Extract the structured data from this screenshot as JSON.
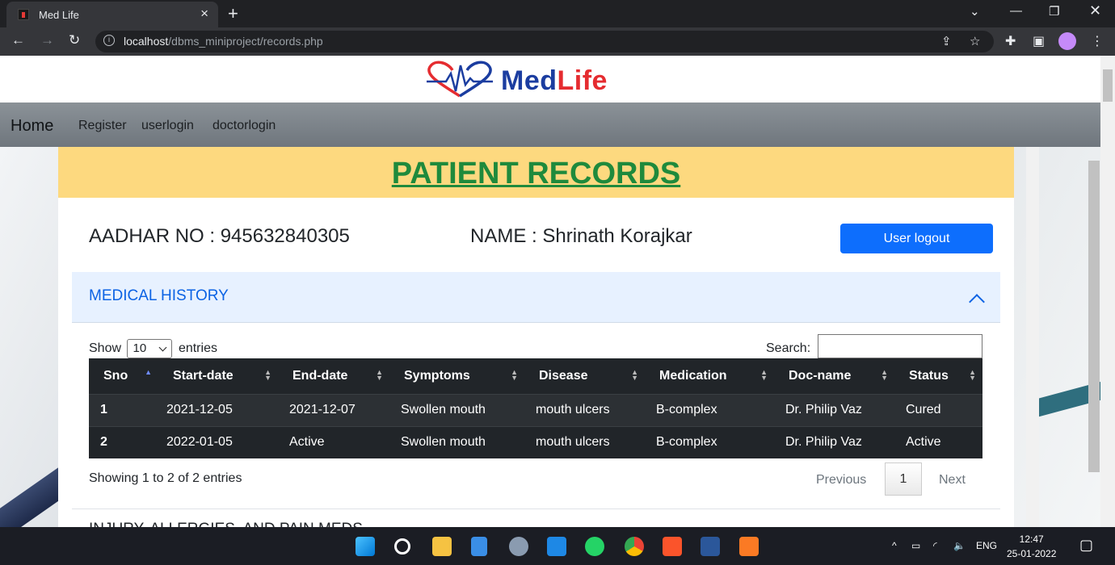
{
  "browser": {
    "tab_title": "Med Life",
    "url_host": "localhost",
    "url_path": "/dbms_miniproject/records.php"
  },
  "site": {
    "logo_med": "Med",
    "logo_life": "Life",
    "nav": {
      "brand": "Home",
      "links": [
        "Register",
        "userlogin",
        "doctorlogin"
      ]
    }
  },
  "records": {
    "banner_title": "PATIENT RECORDS",
    "aadhar": "AADHAR NO : 945632840305",
    "name": "NAME : Shrinath Korajkar",
    "logout_label": "User logout",
    "section_title": "MEDICAL HISTORY",
    "show_label": "Show",
    "entries_value": "10",
    "entries_label": "entries",
    "search_label": "Search:",
    "columns": [
      "Sno",
      "Start-date",
      "End-date",
      "Symptoms",
      "Disease",
      "Medication",
      "Doc-name",
      "Status"
    ],
    "rows": [
      [
        "1",
        "2021-12-05",
        "2021-12-07",
        "Swollen mouth",
        "mouth ulcers",
        "B-complex",
        "Dr. Philip Vaz",
        "Cured"
      ],
      [
        "2",
        "2022-01-05",
        "Active",
        "Swollen mouth",
        "mouth ulcers",
        "B-complex",
        "Dr. Philip Vaz",
        "Active"
      ]
    ],
    "info": "Showing 1 to 2 of 2 entries",
    "pager": {
      "previous": "Previous",
      "current": "1",
      "next": "Next"
    },
    "next_section_title": "INJURY, ALLERGIES, AND PAIN MEDS"
  },
  "taskbar": {
    "lang": "ENG",
    "time": "12:47",
    "date": "25-01-2022"
  },
  "colors": {
    "banner": "#fdd97f",
    "banner_text": "#1f8a3c",
    "primary": "#0d6efd",
    "table_dark": "#212529"
  }
}
